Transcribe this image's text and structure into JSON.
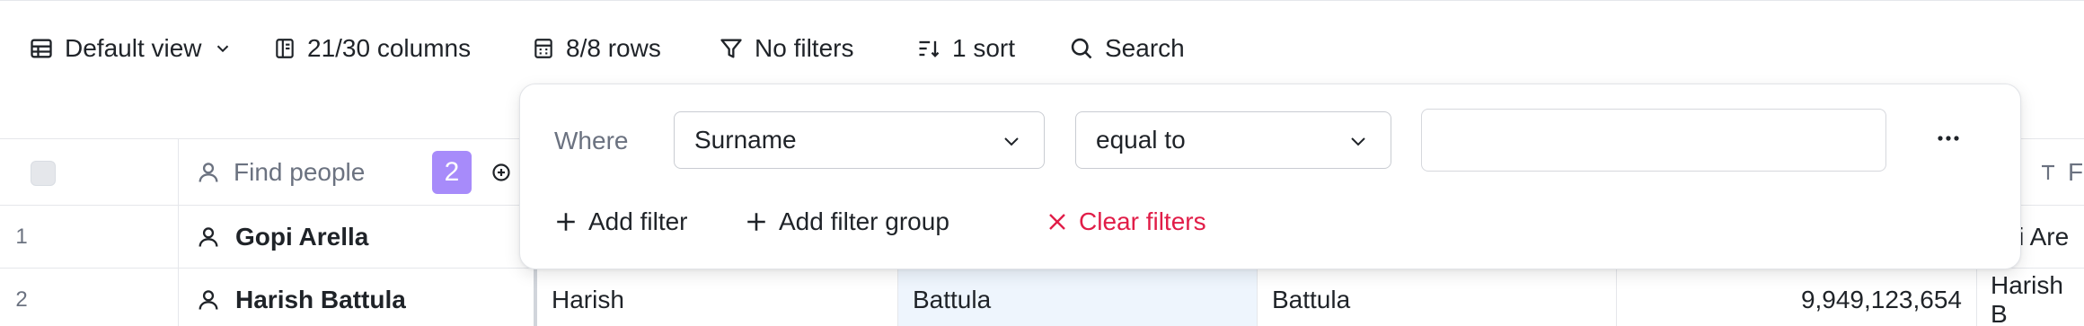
{
  "toolbar": {
    "view_label": "Default view",
    "columns_label": "21/30 columns",
    "rows_label": "8/8 rows",
    "filters_label": "No filters",
    "sort_label": "1 sort",
    "search_label": "Search"
  },
  "grid": {
    "header": {
      "find_people_placeholder": "Find people",
      "badge_count": "2",
      "partial_col_label": "F"
    },
    "rows": [
      {
        "num": "1",
        "name": "Gopi Arella",
        "first": "",
        "surname": "",
        "surname2": "",
        "phone": "",
        "overflow": "opi Are"
      },
      {
        "num": "2",
        "name": "Harish Battula",
        "first": "Harish",
        "surname": "Battula",
        "surname2": "Battula",
        "phone": "9,949,123,654",
        "overflow": "Harish B"
      }
    ]
  },
  "filter_popover": {
    "where_label": "Where",
    "field_value": "Surname",
    "operator_value": "equal to",
    "value_input": "",
    "add_filter_label": "Add filter",
    "add_group_label": "Add filter group",
    "clear_label": "Clear filters"
  },
  "colors": {
    "accent_badge": "#a78bfa",
    "clear_red": "#e11d48",
    "selected_cell_bg": "#eef5fd"
  }
}
